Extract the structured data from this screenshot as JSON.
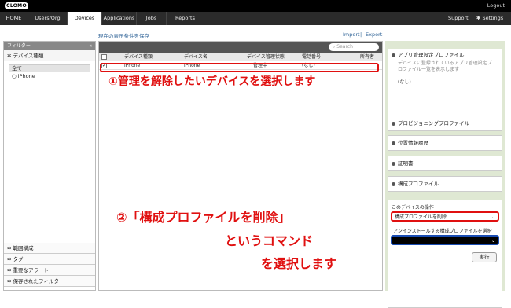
{
  "top": {
    "logo": "CLOMO",
    "account": "",
    "separator": "|",
    "logout": "Logout"
  },
  "nav": {
    "tabs": [
      "HOME",
      "Users/Org",
      "Devices",
      "Applications",
      "Jobs",
      "Reports"
    ],
    "active": "Devices",
    "support": "Support",
    "settings": "Settings"
  },
  "main": {
    "save_view": "現在の表示条件を保存",
    "import": "Import",
    "export": "Export"
  },
  "sidebar": {
    "header": "フィルター",
    "collapse": "«",
    "device_type": "デバイス種類",
    "all": "全て",
    "iphone": "iPhone",
    "bottom": [
      "範囲構成",
      "タグ",
      "重要なアラート",
      "保存されたフィルター"
    ]
  },
  "grid": {
    "search_placeholder": "Search",
    "columns": [
      "デバイス種類",
      "デバイス名",
      "デバイス管理状態",
      "電話番号",
      "所有者"
    ],
    "rows": [
      {
        "type": "iPhone",
        "name": "iPhone",
        "status": "管理中",
        "phone": "(なし)",
        "owner": ""
      }
    ]
  },
  "annotations": {
    "step1": "①管理を解除したいデバイスを選択します",
    "step2_line1": "②「構成プロファイルを削除」",
    "step2_line2": "というコマンド",
    "step2_line3": "を選択します"
  },
  "right": {
    "app_profile_title": "アプリ管理設定プロファイル",
    "app_profile_desc1": "デバイスに登録されているアプリ管理設定プ",
    "app_profile_desc2": "ロファイル一覧を表示します",
    "app_profile_none": "(なし)",
    "provisioning": "プロビジョニングプロファイル",
    "location": "位置情報履歴",
    "certificate": "証明書",
    "config_profile": "構成プロファイル",
    "ops_title": "このデバイスの操作",
    "ops_selected": "構成プロファイルを削除",
    "uninstall_label": "アンインストールする構成プロファイルを選択",
    "exec": "実行"
  },
  "colors": {
    "annotation": "#e01010",
    "right_panel_bg": "#dfe8d3"
  }
}
